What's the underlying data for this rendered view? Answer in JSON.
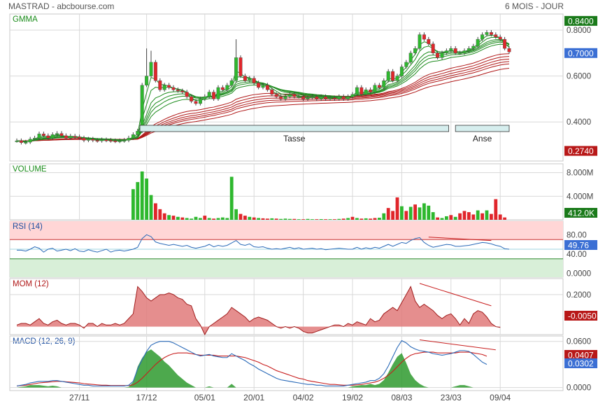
{
  "header": {
    "title": "MASTRAD - abcbourse.com",
    "period": "6 MOIS - JOUR"
  },
  "colors": {
    "up": "#2eb82e",
    "down": "#e0262b",
    "gmma_short": "#1e8c1e",
    "gmma_long": "#b01818",
    "rsi": "#2a6ab8",
    "mom": "#c83232",
    "macd": "#2a6ab8",
    "signal": "#c81e1e",
    "hist": "#2e9a2e",
    "grid": "#d8d8d8",
    "title": "#1a8c1a",
    "label_green": "#1a7a1a",
    "label_blue": "#3b6fd4",
    "label_red": "#b81818"
  },
  "x_axis": {
    "ticks": [
      {
        "label": "27/11",
        "i": 14
      },
      {
        "label": "17/12",
        "i": 29
      },
      {
        "label": "05/01",
        "i": 42
      },
      {
        "label": "20/01",
        "i": 53
      },
      {
        "label": "04/02",
        "i": 64
      },
      {
        "label": "19/02",
        "i": 75
      },
      {
        "label": "08/03",
        "i": 86
      },
      {
        "label": "23/03",
        "i": 97
      },
      {
        "label": "09/04",
        "i": 108
      }
    ]
  },
  "chart_data": [
    {
      "type": "candlestick",
      "title": "GMMA",
      "ylim": [
        0.23,
        0.87
      ],
      "yticks": [
        "0.8000",
        "0.6000",
        "0.4000"
      ],
      "badges": [
        {
          "label": "0.8400",
          "value": 0.84,
          "color": "green"
        },
        {
          "label": "0.7000",
          "value": 0.7,
          "color": "blue"
        },
        {
          "label": "0.2740",
          "value": 0.274,
          "color": "red"
        }
      ],
      "annotations": [
        {
          "label": "Tasse",
          "i0": 27.5,
          "i1": 96.5
        },
        {
          "label": "Anse",
          "i0": 98,
          "i1": 110
        }
      ],
      "close": [
        0.318,
        0.31,
        0.312,
        0.325,
        0.33,
        0.348,
        0.34,
        0.33,
        0.345,
        0.35,
        0.34,
        0.33,
        0.338,
        0.335,
        0.33,
        0.32,
        0.325,
        0.32,
        0.318,
        0.322,
        0.32,
        0.318,
        0.316,
        0.318,
        0.32,
        0.33,
        0.345,
        0.36,
        0.56,
        0.6,
        0.66,
        0.58,
        0.54,
        0.56,
        0.55,
        0.54,
        0.535,
        0.53,
        0.51,
        0.49,
        0.48,
        0.5,
        0.51,
        0.53,
        0.5,
        0.55,
        0.54,
        0.56,
        0.58,
        0.68,
        0.6,
        0.58,
        0.59,
        0.57,
        0.55,
        0.56,
        0.54,
        0.52,
        0.51,
        0.5,
        0.51,
        0.52,
        0.51,
        0.51,
        0.5,
        0.505,
        0.51,
        0.5,
        0.51,
        0.5,
        0.505,
        0.5,
        0.51,
        0.5,
        0.51,
        0.52,
        0.55,
        0.52,
        0.54,
        0.53,
        0.56,
        0.55,
        0.58,
        0.62,
        0.58,
        0.6,
        0.64,
        0.66,
        0.7,
        0.72,
        0.78,
        0.76,
        0.74,
        0.7,
        0.68,
        0.7,
        0.71,
        0.72,
        0.7,
        0.7,
        0.71,
        0.72,
        0.73,
        0.76,
        0.78,
        0.79,
        0.78,
        0.77,
        0.76,
        0.72,
        0.705
      ],
      "gmma_short_last": [
        0.74,
        0.732,
        0.725,
        0.718,
        0.712,
        0.706
      ],
      "gmma_long_last": [
        0.69,
        0.675,
        0.66,
        0.645,
        0.635,
        0.628
      ]
    },
    {
      "type": "bar",
      "title": "VOLUME",
      "ylim": [
        0,
        9500000
      ],
      "yticks": [
        "8.000M",
        "4.000M"
      ],
      "badge": "412.0K",
      "values": [
        0,
        0,
        0,
        0,
        0,
        0,
        0,
        0,
        0,
        0,
        0,
        0,
        0,
        0,
        0,
        0,
        0,
        0,
        0,
        0,
        0,
        0,
        0,
        0,
        0,
        0,
        5200000,
        6400000,
        8200000,
        7000000,
        4200000,
        2800000,
        1800000,
        1100000,
        800000,
        700000,
        500000,
        400000,
        300000,
        200000,
        500000,
        300000,
        700000,
        300000,
        200000,
        300000,
        400000,
        300000,
        7300000,
        1800000,
        1000000,
        700000,
        500000,
        400000,
        300000,
        250000,
        200000,
        250000,
        200000,
        150000,
        200000,
        150000,
        150000,
        100000,
        100000,
        150000,
        100000,
        100000,
        120000,
        100000,
        100000,
        100000,
        150000,
        200000,
        300000,
        500000,
        300000,
        200000,
        250000,
        200000,
        300000,
        350000,
        1100000,
        2000000,
        1500000,
        3800000,
        2300000,
        1500000,
        2200000,
        2600000,
        2100000,
        2800000,
        2400000,
        1300000,
        400000,
        300000,
        600000,
        800000,
        500000,
        1100000,
        1500000,
        1300000,
        900000,
        1600000,
        1100000,
        1600000,
        1000000,
        3500000,
        900000,
        400000
      ],
      "down_days": [
        6,
        9,
        12,
        15,
        19,
        23,
        31,
        32,
        33,
        35,
        37,
        42,
        44,
        50,
        51,
        53,
        55,
        56,
        58,
        62,
        64,
        67,
        69,
        71,
        73,
        75,
        77,
        79,
        80,
        83,
        84,
        85,
        87,
        89,
        94,
        97,
        99,
        100,
        101,
        102,
        104,
        106,
        107,
        108,
        109,
        110
      ]
    },
    {
      "type": "line",
      "title": "RSI (14)",
      "ylim": [
        -8,
        108
      ],
      "yticks": [
        "80.00",
        "40.00",
        "0.0000"
      ],
      "overbought": 70,
      "oversold": 30,
      "badge": "49.76",
      "values": [
        48,
        48,
        46,
        50,
        55,
        52,
        44,
        50,
        52,
        46,
        48,
        50,
        47,
        51,
        46,
        45,
        49,
        46,
        44,
        47,
        50,
        44,
        47,
        48,
        46,
        48,
        50,
        54,
        72,
        80,
        76,
        65,
        62,
        60,
        58,
        60,
        58,
        56,
        58,
        54,
        52,
        54,
        56,
        60,
        55,
        58,
        56,
        58,
        63,
        68,
        60,
        58,
        61,
        55,
        54,
        55,
        52,
        50,
        51,
        50,
        52,
        54,
        51,
        53,
        50,
        51,
        52,
        50,
        51,
        49,
        50,
        51,
        52,
        51,
        50,
        50,
        54,
        50,
        53,
        51,
        54,
        52,
        56,
        60,
        56,
        60,
        64,
        62,
        68,
        72,
        74,
        64,
        58,
        54,
        56,
        58,
        60,
        59,
        56,
        56,
        57,
        58,
        60,
        62,
        64,
        63,
        61,
        58,
        56,
        51,
        50
      ],
      "trendline": {
        "i0": 92,
        "i1": 106,
        "v0": 75,
        "v1": 68
      }
    },
    {
      "type": "area",
      "title": "MOM (12)",
      "ylim": [
        -0.05,
        0.3
      ],
      "yticks": [
        "0.2000"
      ],
      "badge": "-0.0050",
      "values": [
        0.01,
        0.02,
        0.02,
        0.01,
        0.03,
        0.05,
        0.02,
        0.01,
        0.03,
        0.04,
        0.02,
        0.01,
        0.02,
        0.02,
        0.01,
        -0.01,
        0.02,
        0.02,
        0,
        0.02,
        0.01,
        0.01,
        0.02,
        0.01,
        0.02,
        0.05,
        0.08,
        0.25,
        0.22,
        0.18,
        0.16,
        0.18,
        0.2,
        0.2,
        0.21,
        0.2,
        0.18,
        0.17,
        0.14,
        0.13,
        0.05,
        0.01,
        -0.05,
        0.0,
        0.02,
        0.04,
        0.06,
        0.08,
        0.12,
        0.1,
        0.08,
        0.06,
        0.03,
        0.05,
        0.06,
        0.05,
        0.04,
        0.02,
        0.0,
        -0.01,
        0.0,
        -0.01,
        0.0,
        -0.01,
        -0.03,
        -0.04,
        -0.04,
        -0.03,
        -0.02,
        -0.01,
        0.0,
        0.01,
        0.01,
        0.0,
        0.02,
        0.01,
        0.03,
        0.02,
        0.01,
        0.05,
        0.03,
        0.04,
        0.08,
        0.1,
        0.12,
        0.1,
        0.15,
        0.2,
        0.25,
        0.16,
        0.12,
        0.14,
        0.12,
        0.1,
        0.07,
        0.05,
        0.07,
        0.08,
        0.05,
        0.01,
        0.05,
        0.02,
        0.08,
        0.1,
        0.09,
        0.06,
        0.02,
        0.0,
        -0.005
      ],
      "trendline": {
        "i0": 90,
        "i1": 106,
        "v0": 0.27,
        "v1": 0.13
      }
    },
    {
      "type": "line",
      "title": "MACD (12, 26, 9)",
      "ylim": [
        -0.004,
        0.067
      ],
      "yticks": [
        "0.0600",
        "0.0000"
      ],
      "badges": [
        {
          "label": "0.0407",
          "color": "red"
        },
        {
          "label": "0.0302",
          "color": "blue"
        }
      ],
      "series": [
        {
          "name": "macd",
          "values": [
            0.002,
            0.003,
            0.004,
            0.006,
            0.007,
            0.008,
            0.008,
            0.008,
            0.009,
            0.009,
            0.008,
            0.007,
            0.006,
            0.005,
            0.004,
            0.003,
            0.003,
            0.002,
            0.002,
            0.002,
            0.002,
            0.002,
            0.002,
            0.002,
            0.002,
            0.003,
            0.008,
            0.024,
            0.036,
            0.047,
            0.055,
            0.058,
            0.06,
            0.06,
            0.06,
            0.058,
            0.055,
            0.052,
            0.049,
            0.046,
            0.043,
            0.041,
            0.042,
            0.043,
            0.041,
            0.04,
            0.039,
            0.039,
            0.044,
            0.041,
            0.038,
            0.035,
            0.031,
            0.028,
            0.024,
            0.021,
            0.018,
            0.015,
            0.012,
            0.01,
            0.009,
            0.008,
            0.007,
            0.006,
            0.005,
            0.004,
            0.004,
            0.003,
            0.003,
            0.002,
            0.002,
            0.002,
            0.002,
            0.002,
            0.003,
            0.004,
            0.005,
            0.006,
            0.007,
            0.009,
            0.009,
            0.012,
            0.018,
            0.028,
            0.04,
            0.052,
            0.061,
            0.058,
            0.053,
            0.05,
            0.048,
            0.047,
            0.046,
            0.044,
            0.043,
            0.042,
            0.043,
            0.044,
            0.046,
            0.048,
            0.048,
            0.047,
            0.043,
            0.038,
            0.033,
            0.03
          ]
        },
        {
          "name": "signal",
          "values": [
            0.002,
            0.0025,
            0.003,
            0.004,
            0.005,
            0.006,
            0.0065,
            0.007,
            0.0075,
            0.008,
            0.008,
            0.0075,
            0.007,
            0.0065,
            0.006,
            0.005,
            0.0045,
            0.004,
            0.0035,
            0.003,
            0.003,
            0.0025,
            0.0025,
            0.0025,
            0.0025,
            0.0025,
            0.0035,
            0.007,
            0.012,
            0.018,
            0.024,
            0.03,
            0.035,
            0.039,
            0.042,
            0.044,
            0.045,
            0.045,
            0.045,
            0.044,
            0.043,
            0.042,
            0.042,
            0.042,
            0.042,
            0.041,
            0.041,
            0.041,
            0.041,
            0.041,
            0.04,
            0.039,
            0.037,
            0.035,
            0.033,
            0.03,
            0.028,
            0.025,
            0.022,
            0.02,
            0.018,
            0.016,
            0.014,
            0.012,
            0.011,
            0.009,
            0.008,
            0.007,
            0.006,
            0.005,
            0.004,
            0.004,
            0.0035,
            0.003,
            0.003,
            0.003,
            0.0035,
            0.004,
            0.005,
            0.006,
            0.007,
            0.009,
            0.012,
            0.016,
            0.021,
            0.027,
            0.033,
            0.038,
            0.042,
            0.044,
            0.045,
            0.046,
            0.046,
            0.046,
            0.045,
            0.045,
            0.045,
            0.045,
            0.045,
            0.046,
            0.046,
            0.046,
            0.045,
            0.044,
            0.043,
            0.0407
          ]
        }
      ],
      "trendline": {
        "i0": 90,
        "i1": 107,
        "v0": 0.062,
        "v1": 0.049
      }
    }
  ]
}
